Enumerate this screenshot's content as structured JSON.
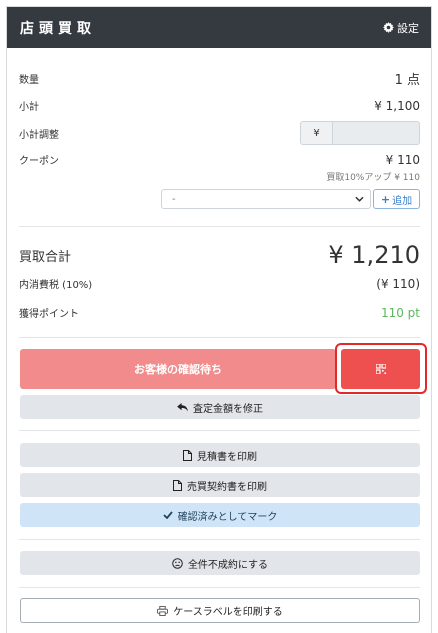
{
  "header": {
    "title": "店頭買取",
    "settings_label": "設定",
    "settings_icon": "gear-icon"
  },
  "summary": {
    "quantity_label": "数量",
    "quantity_value": "1 点",
    "subtotal_label": "小計",
    "subtotal_value": "¥ 1,100",
    "adjust_label": "小計調整",
    "adjust_prefix": "¥",
    "adjust_value": "",
    "coupon_label": "クーポン",
    "coupon_value": "¥ 110",
    "coupon_note": "買取10%アップ ¥ 110",
    "coupon_select_value": "-",
    "add_label": "追加"
  },
  "totals": {
    "total_label": "買取合計",
    "total_value": "¥ 1,210",
    "tax_label": "内消費税 (10%)",
    "tax_value": "(¥ 110)",
    "points_label": "獲得ポイント",
    "points_value": "110 pt"
  },
  "actions": {
    "awaiting_label": "お客様の確認待ち",
    "qr_icon": "qr-code-icon",
    "fix_label": "査定金額を修正",
    "estimate_label": "見積書を印刷",
    "contract_label": "売買契約書を印刷",
    "confirm_label": "確認済みとしてマーク",
    "reject_label": "全件不成約にする",
    "case_label_label": "ケースラベルを印刷する"
  },
  "colors": {
    "header_bg": "#343a40",
    "accent_green": "#5cb85c",
    "awaiting_bg": "#f28c8c",
    "qr_bg": "#ee4f4f",
    "highlight": "#e02a2a"
  }
}
